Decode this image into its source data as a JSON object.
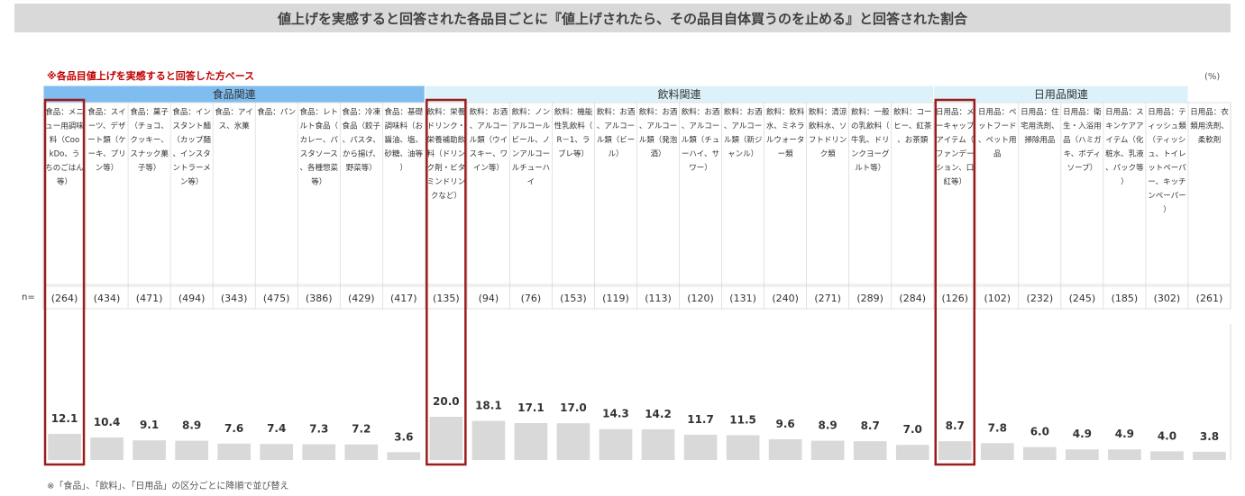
{
  "title": "値上げを実感すると回答された各品目ごとに『値上げされたら、その品目自体買うのを止める』と回答された割合",
  "base_note": "※各品目値上げを実感すると回答した方ベース",
  "unit": "(%)",
  "n_label": "n=",
  "footnote": "※「食品」、「飲料」、「日用品」の区分ごとに降順で並び替え",
  "colors": {
    "title_bg": "#d9d9d9",
    "group_food": "#7fbcf0",
    "group_drink": "#dcf1fa",
    "group_daily": "#dcf1fa",
    "bar": "#d9d9d9",
    "highlight": "#9b1c1c",
    "note_red": "#c00000"
  },
  "chart_data": {
    "type": "bar",
    "groups": [
      {
        "name": "食品関連",
        "count": 9
      },
      {
        "name": "飲料関連",
        "count": 12
      },
      {
        "name": "日用品関連",
        "count": 6
      }
    ],
    "categories": [
      "食品：メニュー用調味料（CookDo、うちのごはん等）",
      "食品：スイーツ、デザート類（ケーキ、プリン等）",
      "食品：菓子（チョコ、クッキー、スナック菓子等）",
      "食品：インスタント麺（カップ麺、インスタントラーメン等）",
      "食品：アイス、氷菓",
      "食品：パン",
      "食品：レトルト食品（カレー、パスタソース、各種惣菜等）",
      "食品：冷凍食品（餃子、パスタ、から揚げ、野菜等）",
      "食品：基礎調味料（お醤油、塩、砂糖、油等）",
      "飲料：栄養ドリンク・栄養補助飲料（ドリンク剤・ビタミンドリンクなど）",
      "飲料：お酒、アルコール類（ウイスキー、ワイン等）",
      "飲料：ノンアルコールビール、ノンアルコールチューハイ",
      "飲料：機能性乳飲料（R－1、ラブレ等）",
      "飲料：お酒、アルコール類（ビール）",
      "飲料：お酒、アルコール類（発泡酒）",
      "飲料：お酒、アルコール類（チューハイ、サワー）",
      "飲料：お酒、アルコール類（新ジャンル）",
      "飲料：飲料水、ミネラルウォーター類",
      "飲料：清涼飲料水、ソフトドリンク類",
      "飲料：一般の乳飲料（牛乳、ドリンクヨーグルト等）",
      "飲料：コーヒー、紅茶、お茶類",
      "日用品：メーキャップアイテム（ファンデーション、口紅等）",
      "日用品：ペットフード、ペット用品",
      "日用品：住宅用洗剤、掃除用品",
      "日用品：衛生・入浴用品（ハミガキ、ボディソープ）",
      "日用品：スキンケアアイテム（化粧水、乳液、パック等）",
      "日用品：ティッシュ類（ティッシュ、トイレットペーパー、キッチンペーパー）",
      "日用品：衣類用洗剤、柔軟剤"
    ],
    "n": [
      "(264)",
      "(434)",
      "(471)",
      "(494)",
      "(343)",
      "(475)",
      "(386)",
      "(429)",
      "(417)",
      "(135)",
      "(94)",
      "(76)",
      "(153)",
      "(119)",
      "(113)",
      "(120)",
      "(131)",
      "(240)",
      "(271)",
      "(289)",
      "(284)",
      "(126)",
      "(102)",
      "(232)",
      "(245)",
      "(185)",
      "(302)",
      "(261)"
    ],
    "values": [
      12.1,
      10.4,
      9.1,
      8.9,
      7.6,
      7.4,
      7.3,
      7.2,
      3.6,
      20.0,
      18.1,
      17.1,
      17.0,
      14.3,
      14.2,
      11.7,
      11.5,
      9.6,
      8.9,
      8.7,
      7.0,
      8.7,
      7.8,
      6.0,
      4.9,
      4.9,
      4.0,
      3.8
    ],
    "value_labels": [
      "12.1",
      "10.4",
      "9.1",
      "8.9",
      "7.6",
      "7.4",
      "7.3",
      "7.2",
      "3.6",
      "20.0",
      "18.1",
      "17.1",
      "17.0",
      "14.3",
      "14.2",
      "11.7",
      "11.5",
      "9.6",
      "8.9",
      "8.7",
      "7.0",
      "8.7",
      "7.8",
      "6.0",
      "4.9",
      "4.9",
      "4.0",
      "3.8"
    ],
    "highlighted": [
      0,
      9,
      21
    ],
    "ylim": [
      0,
      20
    ]
  }
}
